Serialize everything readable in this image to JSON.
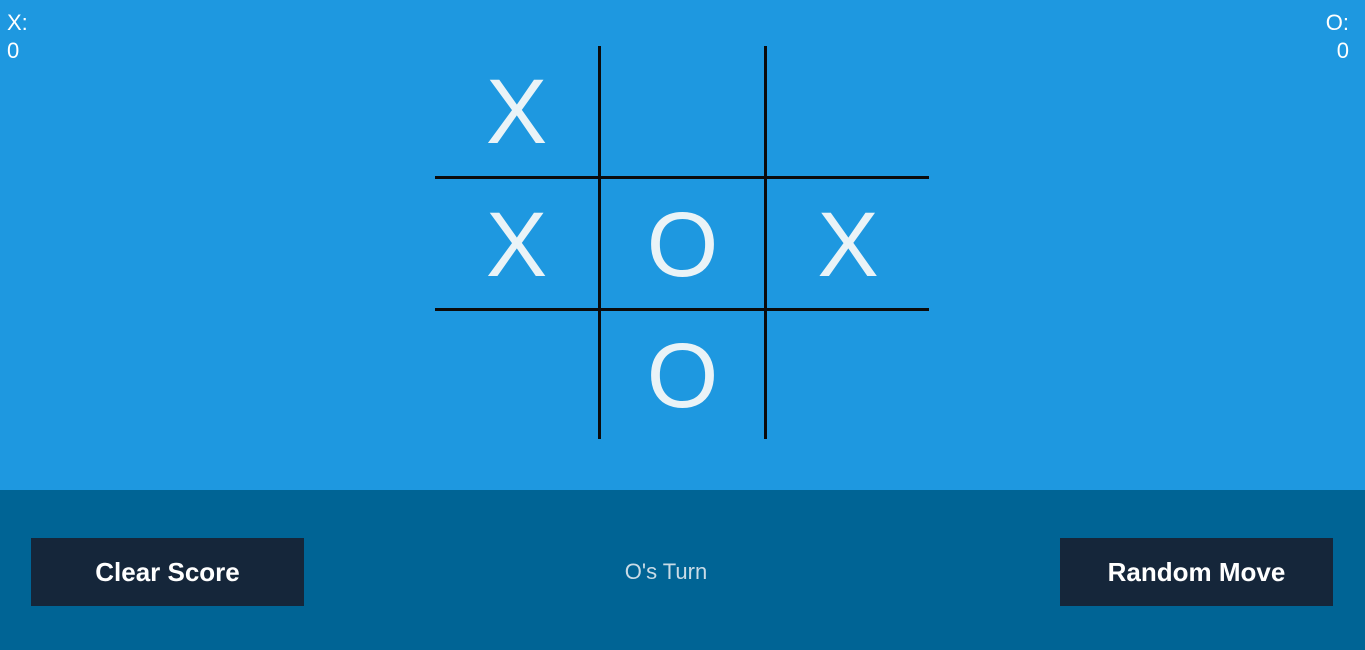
{
  "scores": {
    "x": {
      "label": "X:",
      "value": "0"
    },
    "o": {
      "label": "O:",
      "value": "0"
    }
  },
  "board": {
    "cells": [
      "X",
      "",
      "",
      "X",
      "O",
      "X",
      "",
      "O",
      ""
    ]
  },
  "footer": {
    "clear_label": "Clear Score",
    "status": "O's Turn",
    "random_label": "Random Move"
  }
}
